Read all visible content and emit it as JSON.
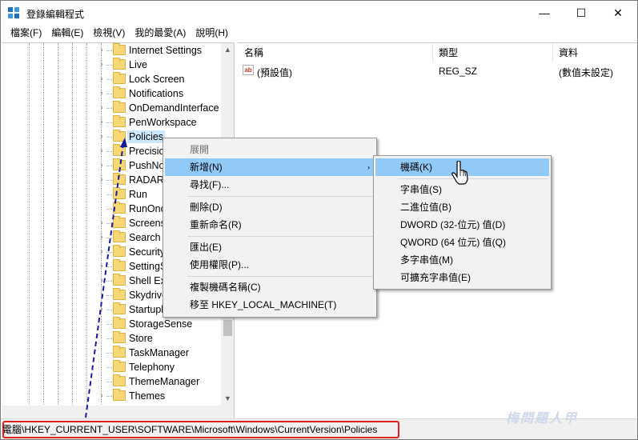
{
  "window": {
    "title": "登錄編輯程式",
    "minimize": "—",
    "maximize": "☐",
    "close": "✕"
  },
  "menubar": [
    {
      "label": "檔案(F)"
    },
    {
      "label": "編輯(E)"
    },
    {
      "label": "檢視(V)"
    },
    {
      "label": "我的最愛(A)"
    },
    {
      "label": "說明(H)"
    }
  ],
  "tree": {
    "items": [
      {
        "label": "Internet Settings",
        "expandable": true
      },
      {
        "label": "Live",
        "expandable": true
      },
      {
        "label": "Lock Screen",
        "expandable": true
      },
      {
        "label": "Notifications",
        "expandable": true
      },
      {
        "label": "OnDemandInterface",
        "expandable": true
      },
      {
        "label": "PenWorkspace",
        "expandable": true
      },
      {
        "label": "Policies",
        "expandable": true,
        "selected": true
      },
      {
        "label": "Precisio",
        "expandable": true
      },
      {
        "label": "PushNo",
        "expandable": true
      },
      {
        "label": "RADAR",
        "expandable": true
      },
      {
        "label": "Run",
        "expandable": false
      },
      {
        "label": "RunOnc",
        "expandable": false
      },
      {
        "label": "Screens",
        "expandable": true
      },
      {
        "label": "Search",
        "expandable": true
      },
      {
        "label": "Security",
        "expandable": true
      },
      {
        "label": "SettingS",
        "expandable": true
      },
      {
        "label": "Shell Ex",
        "expandable": true
      },
      {
        "label": "Skydrive",
        "expandable": true
      },
      {
        "label": "Startupl",
        "expandable": true
      },
      {
        "label": "StorageSense",
        "expandable": false
      },
      {
        "label": "Store",
        "expandable": false
      },
      {
        "label": "TaskManager",
        "expandable": false
      },
      {
        "label": "Telephony",
        "expandable": false
      },
      {
        "label": "ThemeManager",
        "expandable": false
      },
      {
        "label": "Themes",
        "expandable": true
      }
    ]
  },
  "list": {
    "columns": [
      "名稱",
      "類型",
      "資料"
    ],
    "rows": [
      {
        "name": "(預設值)",
        "type": "REG_SZ",
        "data": "(數值未設定)",
        "icon": "ab-string-icon"
      }
    ]
  },
  "context_menu": {
    "items": [
      {
        "label": "展開",
        "disabled": true
      },
      {
        "label": "新增(N)",
        "highlighted": true,
        "submenu": true
      },
      {
        "label": "尋找(F)..."
      },
      {
        "label": "刪除(D)"
      },
      {
        "label": "重新命名(R)"
      },
      {
        "label": "匯出(E)"
      },
      {
        "label": "使用權限(P)..."
      },
      {
        "label": "複製機碼名稱(C)"
      },
      {
        "label": "移至 HKEY_LOCAL_MACHINE(T)"
      }
    ],
    "submenu_arrow": "›"
  },
  "submenu": {
    "items": [
      {
        "label": "機碼(K)",
        "highlighted": true
      },
      {
        "label": "字串值(S)"
      },
      {
        "label": "二進位值(B)"
      },
      {
        "label": "DWORD (32-位元) 值(D)"
      },
      {
        "label": "QWORD (64 位元) 值(Q)"
      },
      {
        "label": "多字串值(M)"
      },
      {
        "label": "可擴充字串值(E)"
      }
    ]
  },
  "statusbar": {
    "path": "電腦\\HKEY_CURRENT_USER\\SOFTWARE\\Microsoft\\Windows\\CurrentVersion\\Policies"
  },
  "watermark": "梅問題人甲",
  "colors": {
    "selection": "#cce8ff",
    "menu_highlight": "#91c9f7",
    "annotation_red": "#e0201c",
    "annotation_arrow": "#1a1aa0",
    "folder": "#f8d775"
  }
}
